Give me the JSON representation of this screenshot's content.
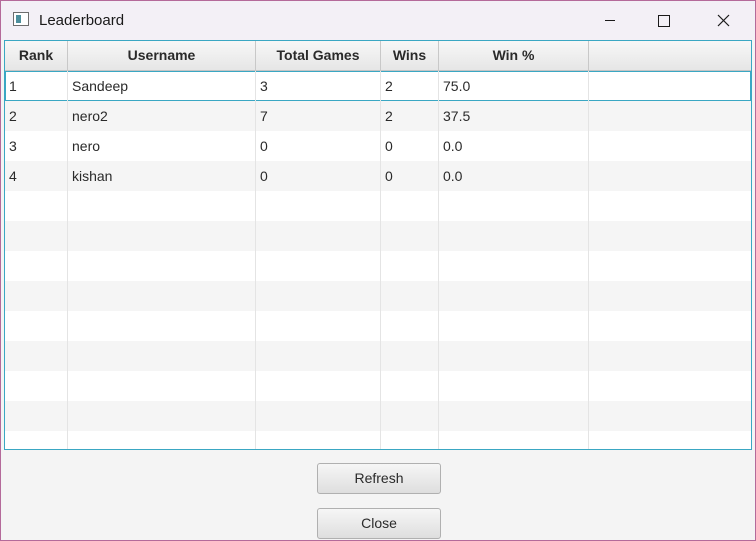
{
  "window": {
    "title": "Leaderboard",
    "controls": [
      "minimize-icon",
      "maximize-icon",
      "close-icon"
    ]
  },
  "table": {
    "columns": [
      "Rank",
      "Username",
      "Total Games",
      "Wins",
      "Win %",
      ""
    ],
    "rows": [
      {
        "rank": "1",
        "username": "Sandeep",
        "total_games": "3",
        "wins": "2",
        "win_pct": "75.0"
      },
      {
        "rank": "2",
        "username": "nero2",
        "total_games": "7",
        "wins": "2",
        "win_pct": "37.5"
      },
      {
        "rank": "3",
        "username": "nero",
        "total_games": "0",
        "wins": "0",
        "win_pct": "0.0"
      },
      {
        "rank": "4",
        "username": "kishan",
        "total_games": "0",
        "wins": "0",
        "win_pct": "0.0"
      }
    ],
    "selected_row": 0
  },
  "buttons": {
    "refresh": "Refresh",
    "close": "Close"
  },
  "colors": {
    "selection_border": "#3aa7c3",
    "window_border": "#b46a9a",
    "titlebar": "#f3f0f6"
  }
}
